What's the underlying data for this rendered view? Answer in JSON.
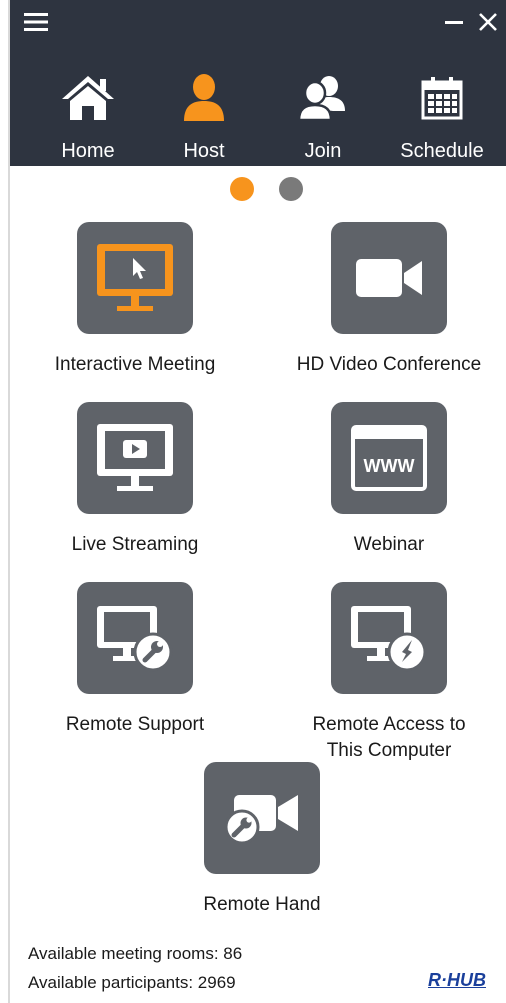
{
  "nav": {
    "items": [
      {
        "label": "Home",
        "icon": "home-icon"
      },
      {
        "label": "Host",
        "icon": "user-icon"
      },
      {
        "label": "Join",
        "icon": "users-icon"
      },
      {
        "label": "Schedule",
        "icon": "calendar-icon"
      }
    ],
    "active": "Host"
  },
  "pager": {
    "active_page": 1,
    "total_pages": 2
  },
  "tiles": [
    {
      "label": "Interactive Meeting",
      "icon": "monitor-cursor-icon"
    },
    {
      "label": "HD Video Conference",
      "icon": "video-camera-icon"
    },
    {
      "label": "Live Streaming",
      "icon": "monitor-play-icon"
    },
    {
      "label": "Webinar",
      "icon": "browser-www-icon"
    },
    {
      "label": "Remote Support",
      "icon": "monitor-wrench-icon"
    },
    {
      "label_line1": "Remote Access to",
      "label_line2": "This Computer",
      "icon": "monitor-plug-icon"
    },
    {
      "label": "Remote Hand",
      "icon": "camera-wrench-icon"
    }
  ],
  "footer": {
    "rooms": "Available meeting rooms: 86",
    "participants": "Available participants: 2969",
    "brand": "R·HUB"
  },
  "colors": {
    "header_bg": "#2e3440",
    "accent": "#f7941d",
    "tile_bg": "#5f6369",
    "inactive_dot": "#7a7a7a",
    "brand": "#1a3f9b"
  }
}
